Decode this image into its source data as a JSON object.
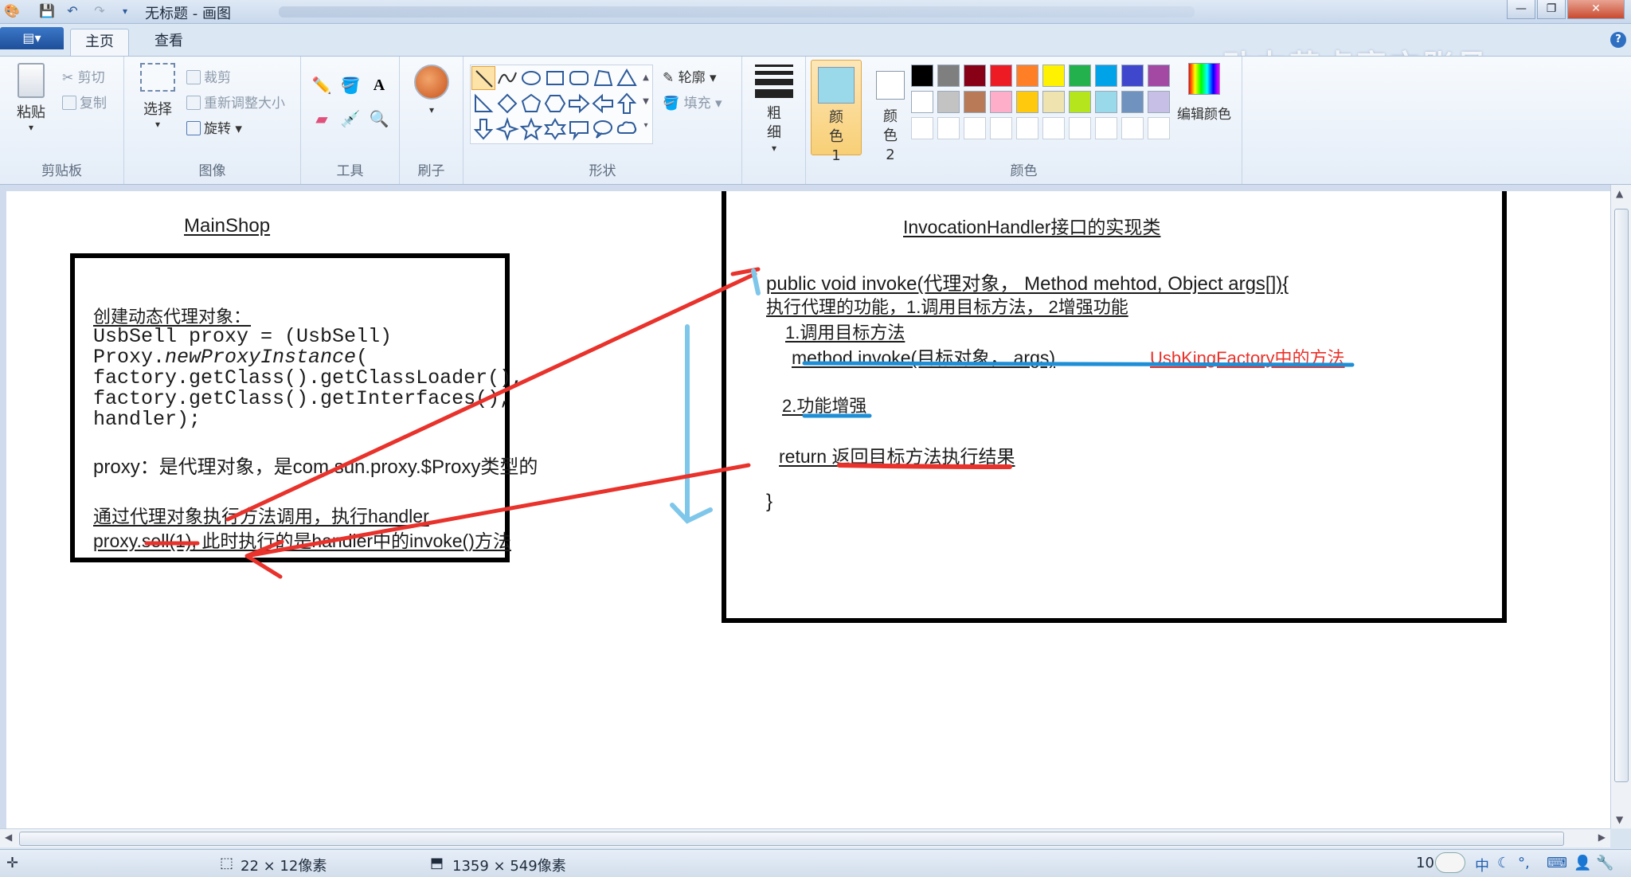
{
  "window": {
    "title": "无标题 - 画图",
    "controls": [
      "minimize",
      "maximize",
      "close"
    ]
  },
  "quick_access": [
    "paint-app-icon",
    "save-icon",
    "undo-icon",
    "redo-icon",
    "customize-icon"
  ],
  "tabs": {
    "app_menu": "▤▾",
    "home": "主页",
    "view": "查看"
  },
  "watermark": "动力节点官方账号",
  "ribbon": {
    "clipboard": {
      "paste": "粘贴",
      "cut": "剪切",
      "copy": "复制",
      "label": "剪贴板"
    },
    "image": {
      "select": "选择",
      "crop": "裁剪",
      "resize": "重新调整大小",
      "rotate": "旋转",
      "label": "图像"
    },
    "tools": {
      "label": "工具"
    },
    "brushes": {
      "label": "刷子"
    },
    "shapes": {
      "outline": "轮廓",
      "fill": "填充",
      "label": "形状"
    },
    "size": {
      "label": "粗细"
    },
    "colors": {
      "color1": "颜色 1",
      "color2": "颜色 2",
      "edit": "编辑颜色",
      "label": "颜色",
      "color1_value": "#99d9ea",
      "color2_value": "#ffffff",
      "row1": [
        "#000000",
        "#7f7f7f",
        "#880015",
        "#ed1c24",
        "#ff7f27",
        "#fff200",
        "#22b14c",
        "#00a2e8",
        "#3f48cc",
        "#a349a4"
      ],
      "row2": [
        "#ffffff",
        "#c3c3c3",
        "#b97a57",
        "#ffaec9",
        "#ffc90e",
        "#efe4b0",
        "#b5e61d",
        "#99d9ea",
        "#7092be",
        "#c8bfe7"
      ]
    }
  },
  "canvas": {
    "left_title": "MainShop",
    "left_lines": {
      "l1": "创建动态代理对象：",
      "l2": "UsbSell proxy = (UsbSell)",
      "l3_a": "Proxy.",
      "l3_b": "newProxyInstance",
      "l3_c": "(",
      "l4": "factory.getClass().getClassLoader(),",
      "l5": "factory.getClass().getInterfaces(),",
      "l6": "handler);",
      "l7": "proxy：是代理对象，是com.sun.proxy.$Proxy类型的",
      "l8": "通过代理对象执行方法调用，执行handler",
      "l9": "proxy.sell(1), 此时执行的是handler中的invoke()方法"
    },
    "right_title": "InvocationHandler接口的实现类",
    "right_lines": {
      "r1": "public void invoke(代理对象， Method mehtod, Object args[]){",
      "r2": "执行代理的功能，1.调用目标方法， 2增强功能",
      "r3": "1.调用目标方法",
      "r4": "method.invoke(目标对象， args)",
      "r4_note": "UsbKingFactory中的方法",
      "r5": "2.功能增强",
      "r6": "return 返回目标方法执行结果",
      "r7": "}"
    }
  },
  "status": {
    "selection_size": "22 × 12像素",
    "canvas_size": "1359 × 549像素",
    "zoom_partial": "10",
    "ime": "中"
  }
}
